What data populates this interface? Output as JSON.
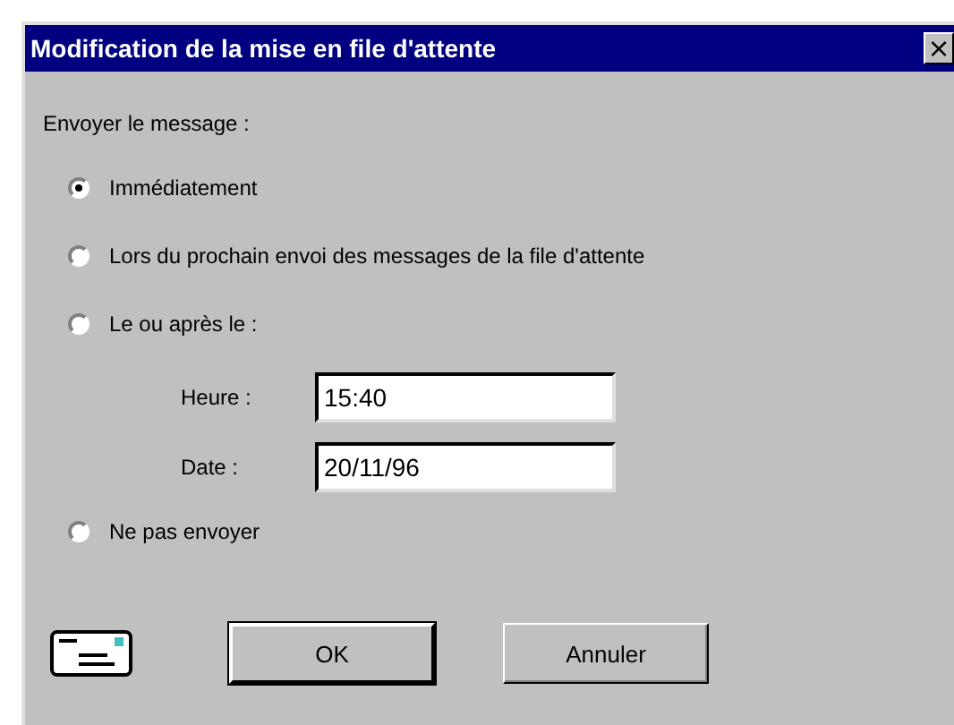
{
  "window": {
    "title": "Modification de la mise en file d'attente",
    "close_button": "×"
  },
  "prompt": "Envoyer le message :",
  "options": [
    {
      "label": "Immédiatement",
      "selected": true
    },
    {
      "label": "Lors du prochain envoi des messages de la file d'attente",
      "selected": false
    },
    {
      "label": "Le ou après le :",
      "selected": false
    },
    {
      "label": "Ne pas envoyer",
      "selected": false
    }
  ],
  "fields": [
    {
      "label": "Heure :",
      "value": "15:40"
    },
    {
      "label": "Date :",
      "value": "20/11/96"
    }
  ],
  "buttons": [
    {
      "label": "OK",
      "default": true
    },
    {
      "label": "Annuler",
      "default": false
    }
  ]
}
